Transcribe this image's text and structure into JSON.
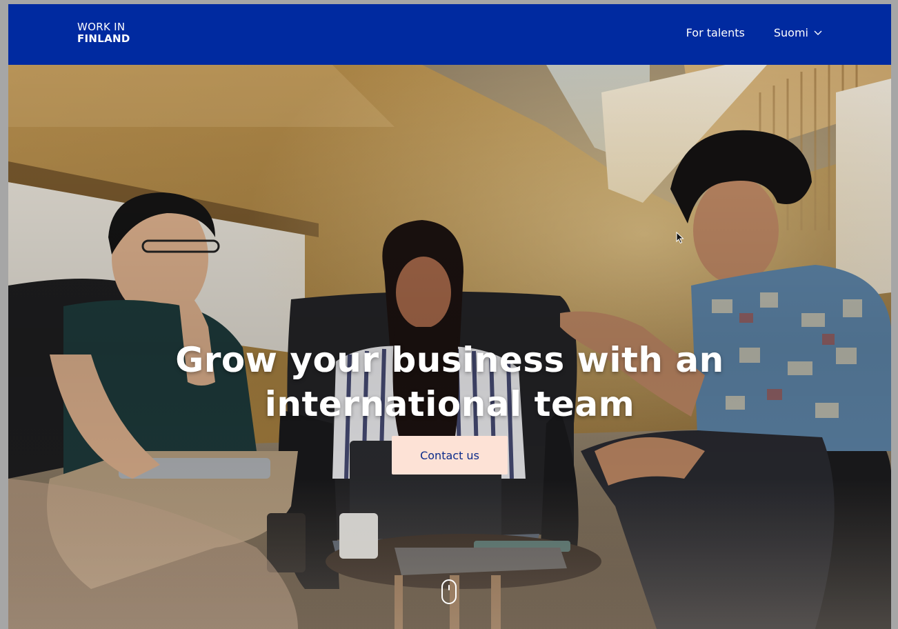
{
  "header": {
    "logo_line1": "WORK IN",
    "logo_line2": "FINLAND",
    "nav": {
      "for_talents": "For talents",
      "language": "Suomi"
    },
    "background_color": "#002aa0"
  },
  "hero": {
    "headline_line1": "Grow your business with an",
    "headline_line2": "international team",
    "cta_label": "Contact us",
    "cta_color": "#fde2d6"
  },
  "icons": {
    "language_dropdown": "chevron-down-icon",
    "scroll_indicator": "mouse-scroll-icon",
    "pointer": "cursor-icon"
  }
}
